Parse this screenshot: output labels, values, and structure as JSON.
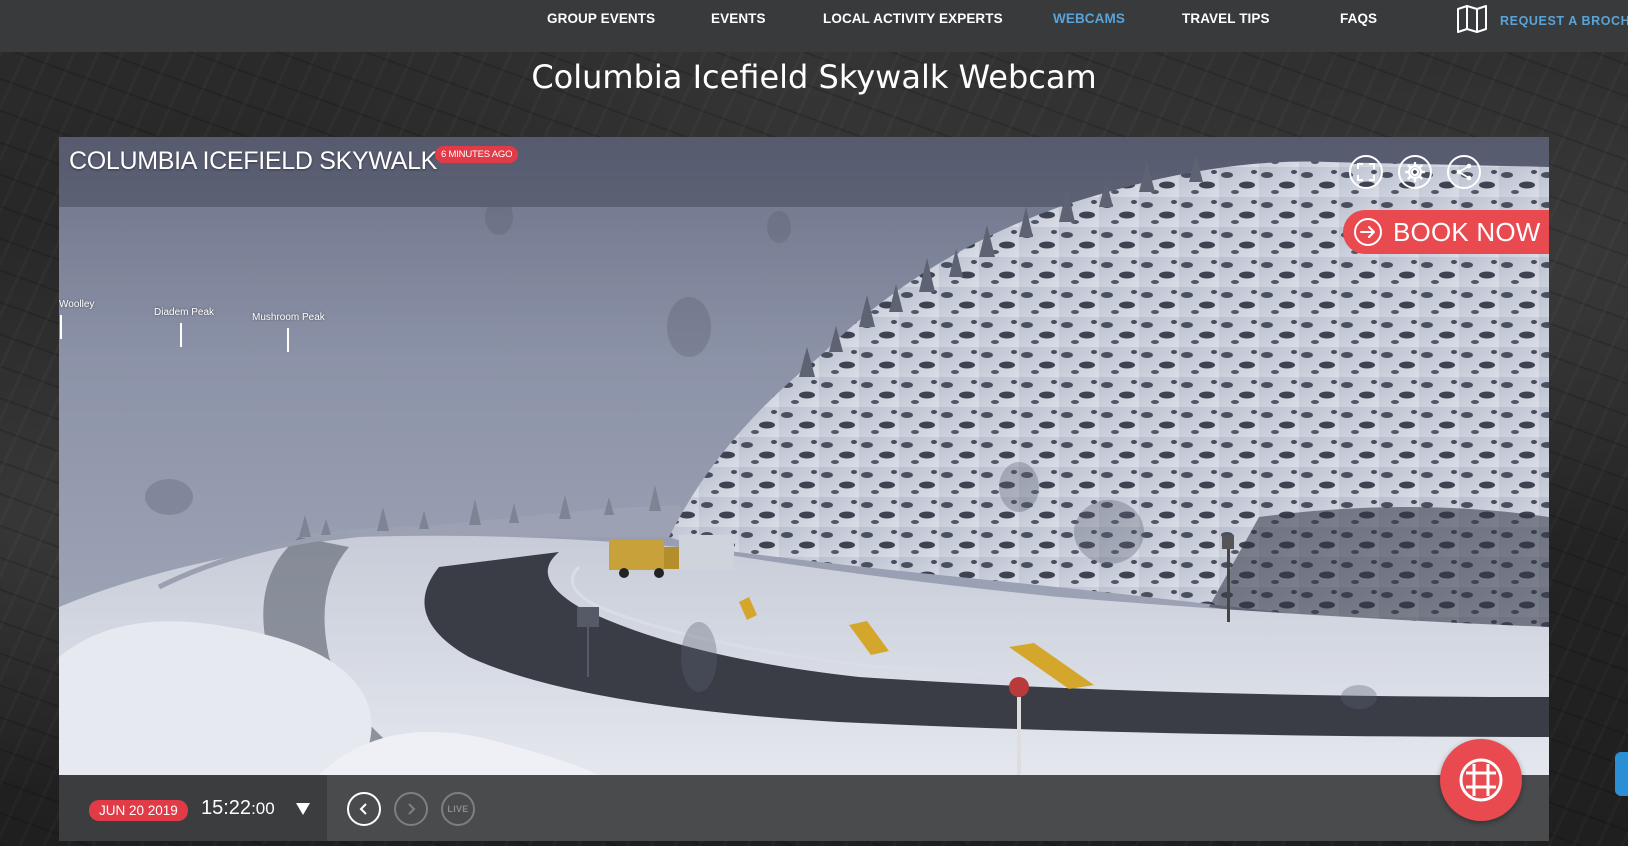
{
  "nav": {
    "items": [
      {
        "label": "GROUP EVENTS",
        "active": false
      },
      {
        "label": "EVENTS",
        "active": false
      },
      {
        "label": "LOCAL ACTIVITY EXPERTS",
        "active": false
      },
      {
        "label": "WEBCAMS",
        "active": true
      },
      {
        "label": "TRAVEL TIPS",
        "active": false
      },
      {
        "label": "FAQS",
        "active": false
      }
    ],
    "brochure_label": "REQUEST A BROCH",
    "brochure_icon": "map-icon",
    "active_color": "#5aa3d8"
  },
  "page_title": "Columbia Icefield Skywalk Webcam",
  "webcam": {
    "title": "COLUMBIA ICEFIELD SKYWALK",
    "age_badge": "6 MINUTES AGO",
    "peaks": [
      "Woolley",
      "Diadem Peak",
      "Mushroom Peak"
    ],
    "controls": [
      "fullscreen-icon",
      "gear-icon",
      "share-icon"
    ],
    "book_now_label": "BOOK NOW",
    "accent_color": "#e84a4f"
  },
  "timeline": {
    "date": "JUN 20 2019",
    "time_main": "15:22",
    "time_seconds": ":00",
    "live_label": "LIVE",
    "icons": [
      "chevron-down-icon",
      "chevron-left-icon",
      "chevron-right-icon",
      "grid-icon"
    ]
  }
}
